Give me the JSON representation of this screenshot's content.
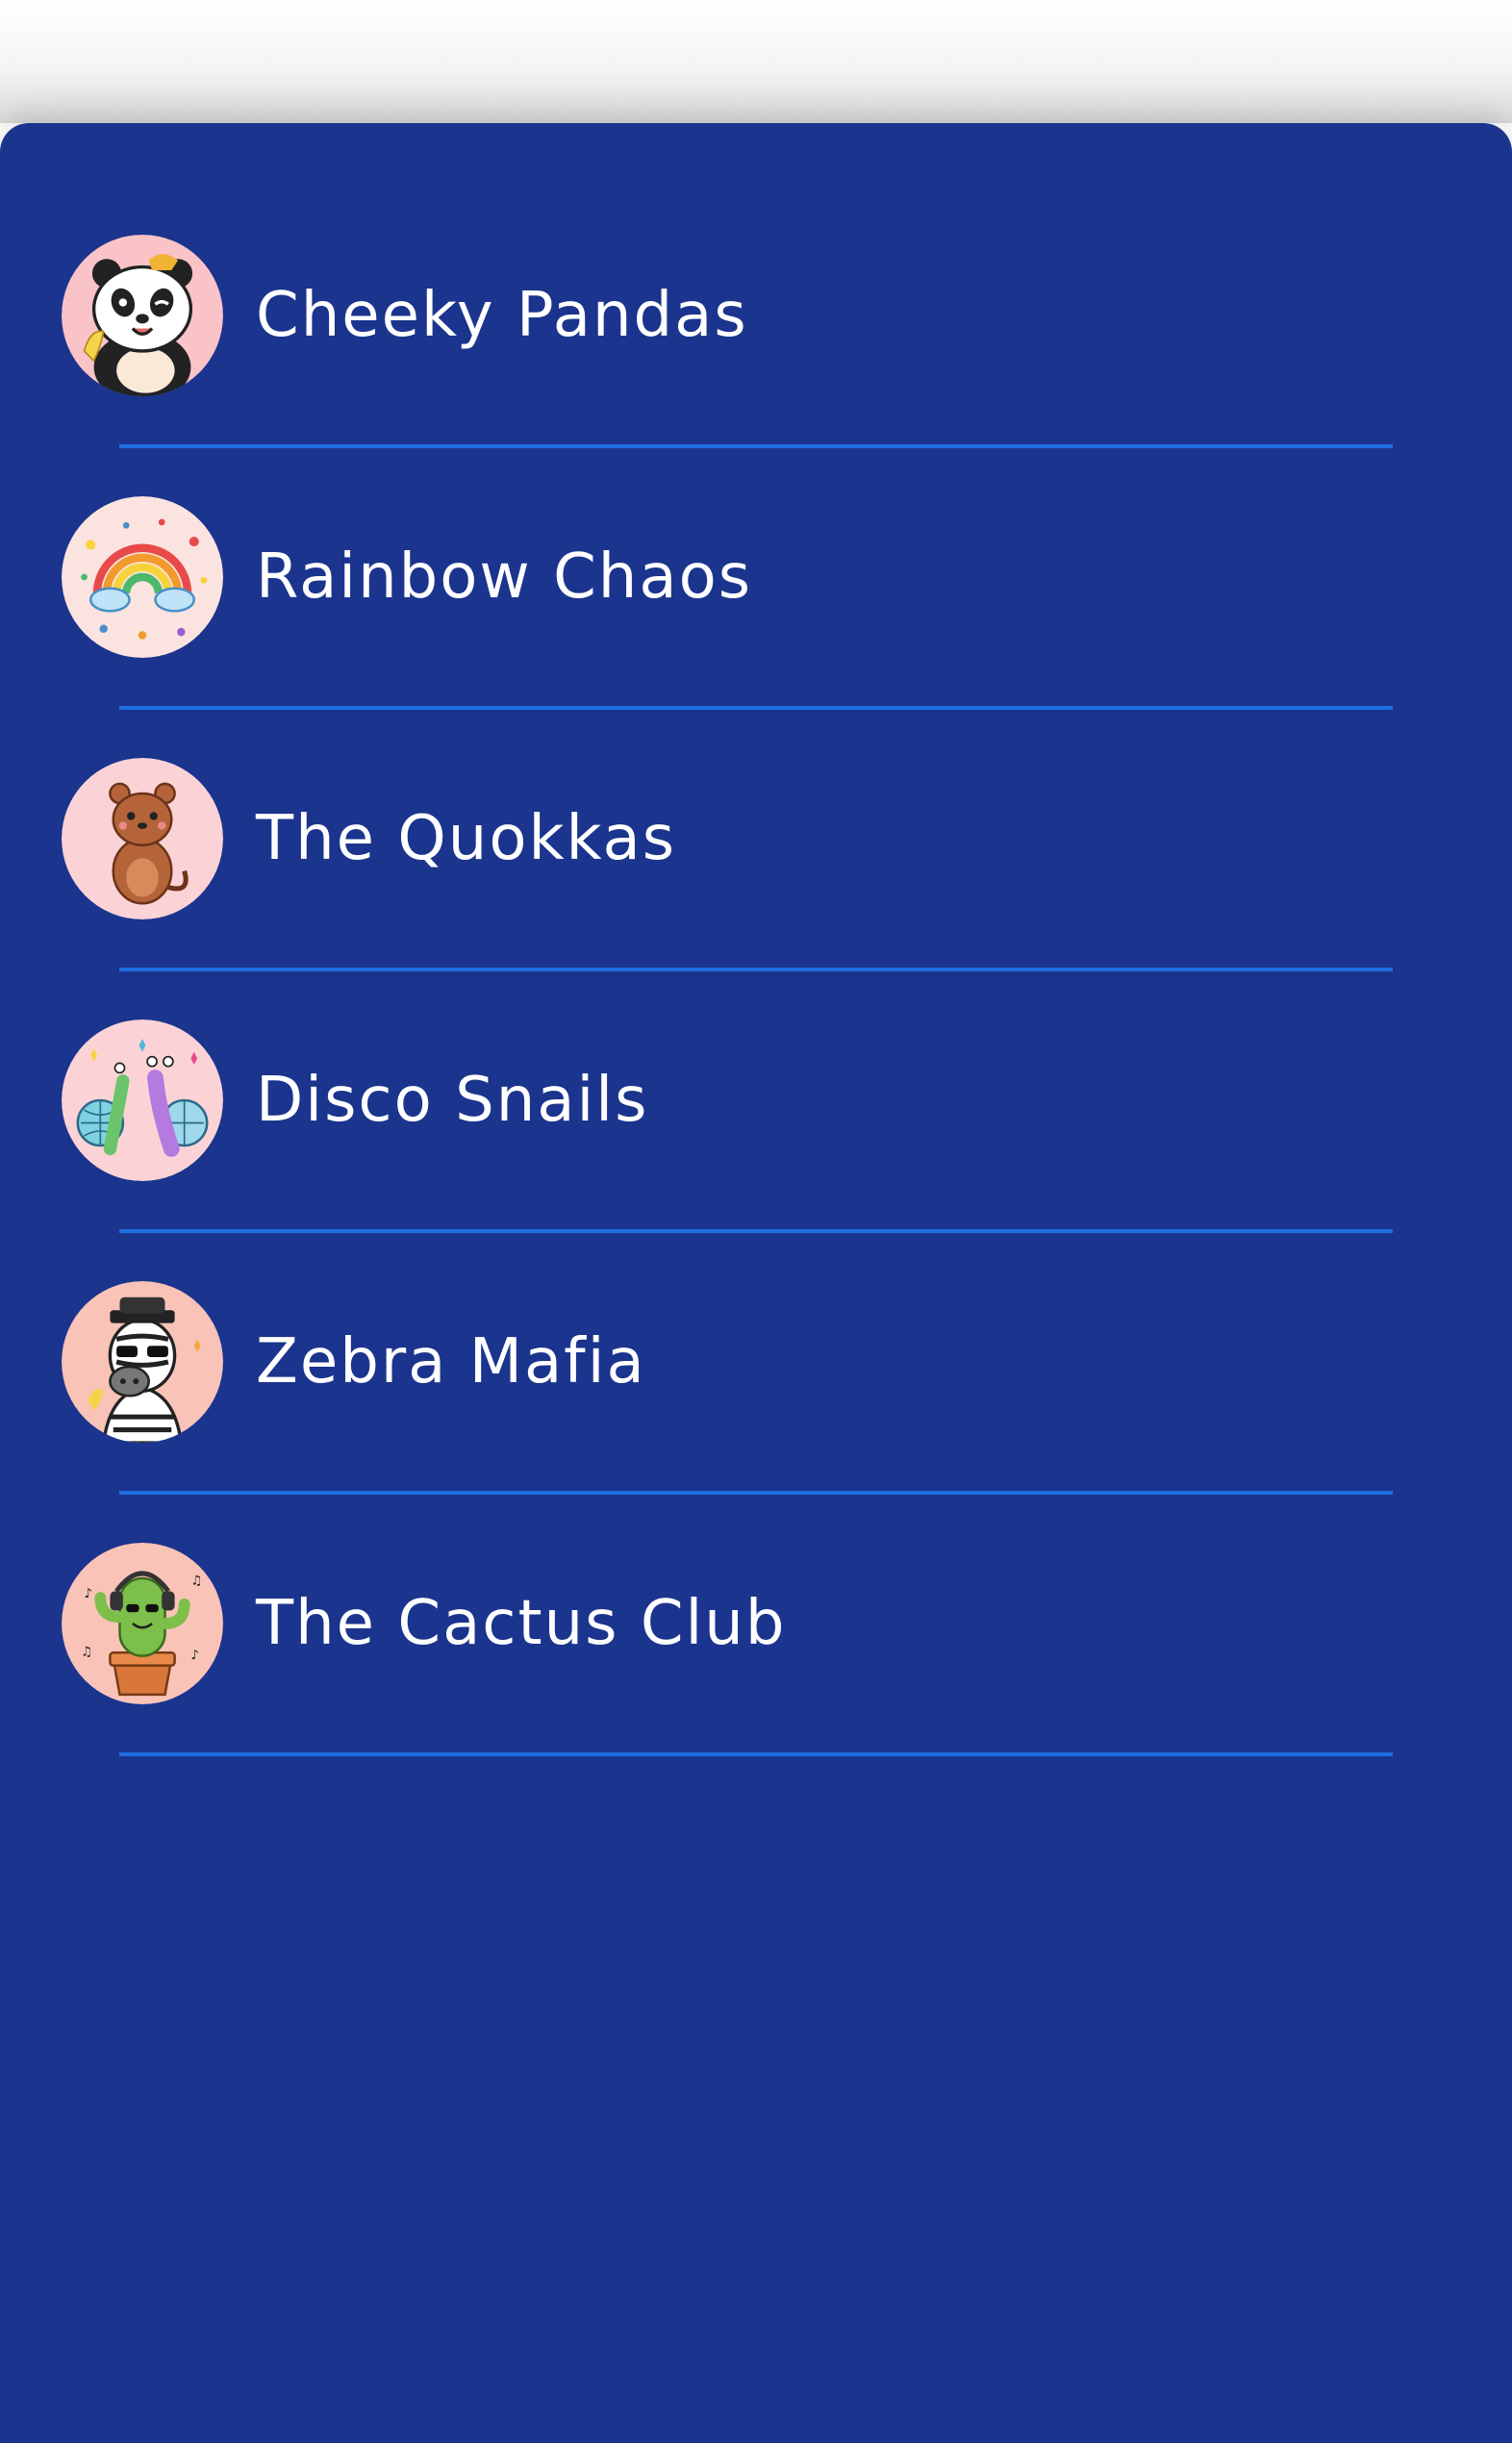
{
  "teams": [
    {
      "name": "Cheeky Pandas",
      "avatar_icon": "panda-avatar-icon"
    },
    {
      "name": "Rainbow Chaos",
      "avatar_icon": "rainbow-avatar-icon"
    },
    {
      "name": "The Quokkas",
      "avatar_icon": "quokka-avatar-icon"
    },
    {
      "name": "Disco Snails",
      "avatar_icon": "snails-avatar-icon"
    },
    {
      "name": "Zebra Mafia",
      "avatar_icon": "zebra-avatar-icon"
    },
    {
      "name": "The Cactus Club",
      "avatar_icon": "cactus-avatar-icon"
    }
  ],
  "colors": {
    "panel_background": "#1b348d",
    "divider": "#1f6fe0",
    "text": "#ffffff",
    "avatar_background": "#fbd3d6"
  }
}
